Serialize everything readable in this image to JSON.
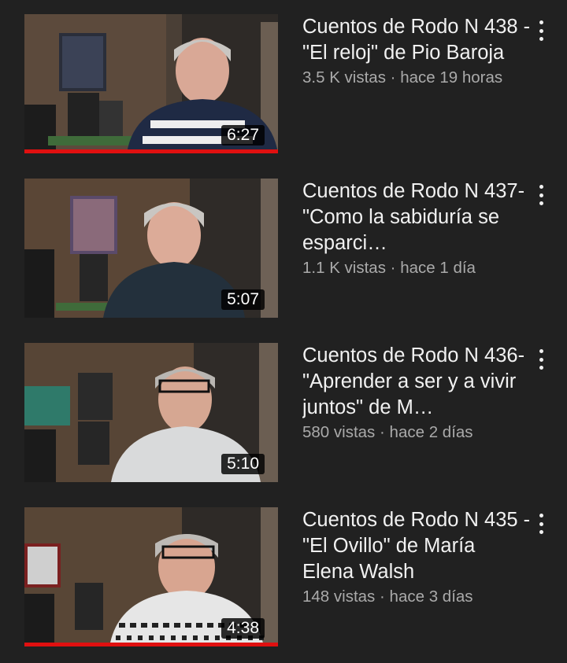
{
  "videos": [
    {
      "title": "Cuentos de Rodo N 438 - \"El reloj\" de Pio Baroja",
      "views": "3.5 K vistas",
      "separator": "·",
      "age": "hace 19 horas",
      "duration": "6:27",
      "watched_fraction": 1.0,
      "menu_icon": "more-vert-icon"
    },
    {
      "title": "Cuentos de Rodo N 437-\"Como la sabiduría se esparci…",
      "views": "1.1 K vistas",
      "separator": "·",
      "age": "hace 1 día",
      "duration": "5:07",
      "watched_fraction": 0,
      "menu_icon": "more-vert-icon"
    },
    {
      "title": "Cuentos de Rodo N 436-\"Aprender a ser y a vivir juntos\" de M…",
      "views": "580 vistas",
      "separator": "·",
      "age": "hace 2 días",
      "duration": "5:10",
      "watched_fraction": 0,
      "menu_icon": "more-vert-icon"
    },
    {
      "title": "Cuentos de Rodo N 435 - \"El Ovillo\" de María Elena Walsh",
      "views": "148 vistas",
      "separator": "·",
      "age": "hace 3 días",
      "duration": "4:38",
      "watched_fraction": 1.0,
      "menu_icon": "more-vert-icon"
    }
  ],
  "colors": {
    "background": "#212121",
    "title_text": "#f1f1f1",
    "meta_text": "#aaaaaa",
    "progress": "#e01010"
  }
}
